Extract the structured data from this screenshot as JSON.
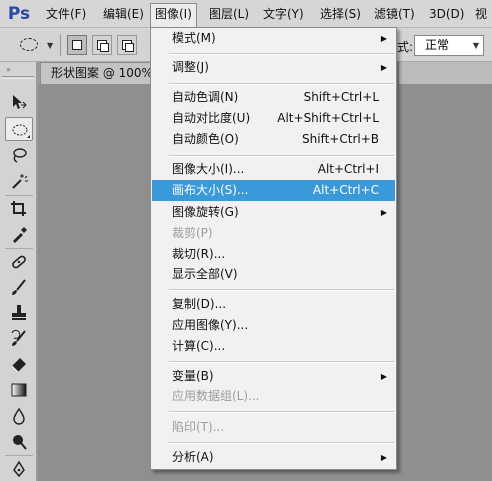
{
  "app_logo": "Ps",
  "menubar": {
    "items": [
      {
        "label": "文件(F)"
      },
      {
        "label": "编辑(E)"
      },
      {
        "label": "图像(I)"
      },
      {
        "label": "图层(L)"
      },
      {
        "label": "文字(Y)"
      },
      {
        "label": "选择(S)"
      },
      {
        "label": "滤镜(T)"
      },
      {
        "label": "3D(D)"
      },
      {
        "label": "视"
      }
    ]
  },
  "options_bar": {
    "style_label": "式:",
    "style_value": "正常"
  },
  "document_tab": {
    "label": "形状图案 @ 100%"
  },
  "image_menu": {
    "items": [
      {
        "label": "模式(M)",
        "shortcut": "",
        "submenu": true,
        "enabled": true
      },
      {
        "label": "调整(J)",
        "shortcut": "",
        "submenu": true,
        "enabled": true
      },
      {
        "label": "自动色调(N)",
        "shortcut": "Shift+Ctrl+L",
        "enabled": true
      },
      {
        "label": "自动对比度(U)",
        "shortcut": "Alt+Shift+Ctrl+L",
        "enabled": true
      },
      {
        "label": "自动颜色(O)",
        "shortcut": "Shift+Ctrl+B",
        "enabled": true
      },
      {
        "label": "图像大小(I)...",
        "shortcut": "Alt+Ctrl+I",
        "enabled": true
      },
      {
        "label": "画布大小(S)...",
        "shortcut": "Alt+Ctrl+C",
        "enabled": true,
        "highlighted": true
      },
      {
        "label": "图像旋转(G)",
        "shortcut": "",
        "submenu": true,
        "enabled": true
      },
      {
        "label": "裁剪(P)",
        "shortcut": "",
        "enabled": false
      },
      {
        "label": "裁切(R)...",
        "shortcut": "",
        "enabled": true
      },
      {
        "label": "显示全部(V)",
        "shortcut": "",
        "enabled": true
      },
      {
        "label": "复制(D)...",
        "shortcut": "",
        "enabled": true
      },
      {
        "label": "应用图像(Y)...",
        "shortcut": "",
        "enabled": true
      },
      {
        "label": "计算(C)...",
        "shortcut": "",
        "enabled": true
      },
      {
        "label": "变量(B)",
        "shortcut": "",
        "submenu": true,
        "enabled": true
      },
      {
        "label": "应用数据组(L)...",
        "shortcut": "",
        "enabled": false
      },
      {
        "label": "陷印(T)...",
        "shortcut": "",
        "enabled": false
      },
      {
        "label": "分析(A)",
        "shortcut": "",
        "submenu": true,
        "enabled": true
      }
    ]
  },
  "colors": {
    "highlight": "#3a9ad9",
    "logo": "#2a48a8",
    "disabled_text": "#9d9d9d"
  },
  "toolbox": {
    "tools": [
      "move-tool-icon",
      "elliptical-marquee-tool-icon",
      "lasso-tool-icon",
      "magic-wand-tool-icon",
      "crop-tool-icon",
      "eyedropper-tool-icon",
      "healing-brush-tool-icon",
      "brush-tool-icon",
      "clone-stamp-tool-icon",
      "history-brush-tool-icon",
      "eraser-tool-icon",
      "gradient-tool-icon",
      "blur-tool-icon",
      "dodge-tool-icon",
      "pen-tool-icon"
    ]
  }
}
